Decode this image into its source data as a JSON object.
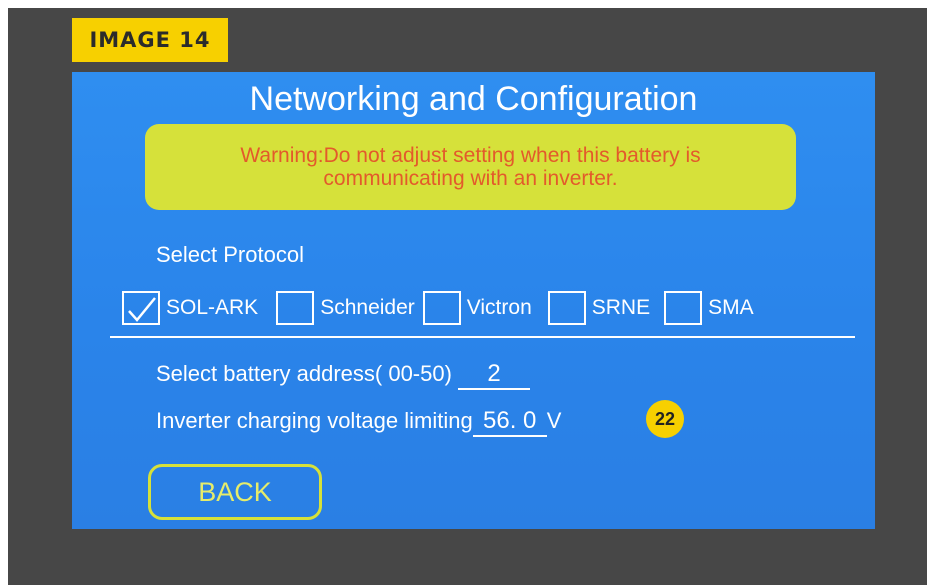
{
  "tag": "IMAGE 14",
  "screen": {
    "title": "Networking and Configuration",
    "warning": "Warning:Do not adjust setting when this battery is\ncommunicating with an inverter.",
    "select_protocol_label": "Select Protocol",
    "protocols": [
      {
        "label": "SOL-ARK",
        "checked": true
      },
      {
        "label": "Schneider",
        "checked": false
      },
      {
        "label": "Victron",
        "checked": false
      },
      {
        "label": "SRNE",
        "checked": false
      },
      {
        "label": "SMA",
        "checked": false
      }
    ],
    "battery_address_label": "Select battery address( 00-50)",
    "battery_address_value": "2",
    "charging_voltage_label": "Inverter charging voltage limiting",
    "charging_voltage_value": "56. 0",
    "charging_voltage_unit": "V",
    "back_label": "BACK"
  },
  "callout": "22",
  "colors": {
    "screen_bg": "#2b86ec",
    "warning_bg": "#d6e13a",
    "warning_text": "#e35a2b",
    "tag_bg": "#f7d000",
    "bezel": "#474747"
  }
}
